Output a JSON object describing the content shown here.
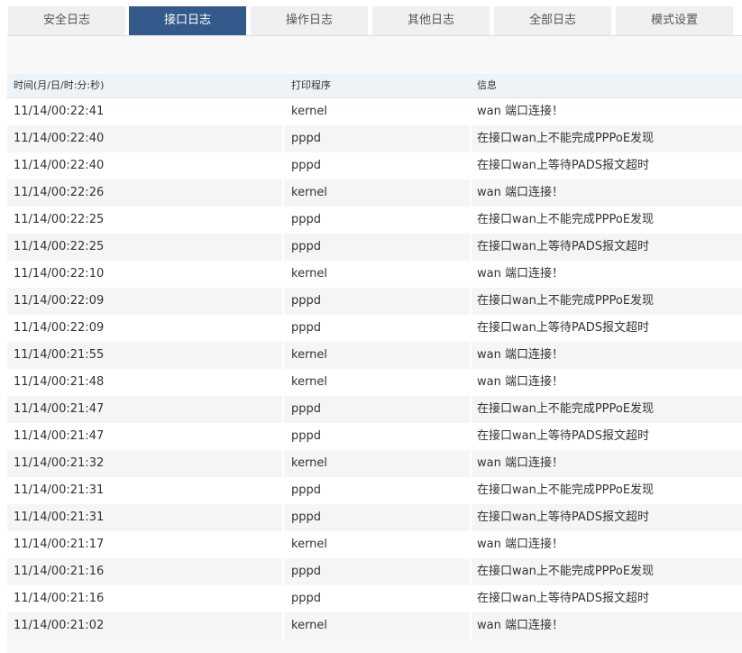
{
  "tabs": [
    {
      "label": "安全日志",
      "active": false
    },
    {
      "label": "接口日志",
      "active": true
    },
    {
      "label": "操作日志",
      "active": false
    },
    {
      "label": "其他日志",
      "active": false
    },
    {
      "label": "全部日志",
      "active": false
    },
    {
      "label": "模式设置",
      "active": false
    }
  ],
  "colors": {
    "active_tab": "#345a8c",
    "inactive_tab": "#f0f0f0",
    "header_bg": "#eef3f8"
  },
  "table": {
    "headers": {
      "time": "时间(月/日/时:分:秒)",
      "program": "打印程序",
      "info": "信息"
    },
    "rows": [
      {
        "time": "11/14/00:22:41",
        "program": "kernel",
        "info": "wan 端口连接！"
      },
      {
        "time": "11/14/00:22:40",
        "program": "pppd",
        "info": "在接口wan上不能完成PPPoE发现"
      },
      {
        "time": "11/14/00:22:40",
        "program": "pppd",
        "info": "在接口wan上等待PADS报文超时"
      },
      {
        "time": "11/14/00:22:26",
        "program": "kernel",
        "info": "wan 端口连接！"
      },
      {
        "time": "11/14/00:22:25",
        "program": "pppd",
        "info": "在接口wan上不能完成PPPoE发现"
      },
      {
        "time": "11/14/00:22:25",
        "program": "pppd",
        "info": "在接口wan上等待PADS报文超时"
      },
      {
        "time": "11/14/00:22:10",
        "program": "kernel",
        "info": "wan 端口连接！"
      },
      {
        "time": "11/14/00:22:09",
        "program": "pppd",
        "info": "在接口wan上不能完成PPPoE发现"
      },
      {
        "time": "11/14/00:22:09",
        "program": "pppd",
        "info": "在接口wan上等待PADS报文超时"
      },
      {
        "time": "11/14/00:21:55",
        "program": "kernel",
        "info": "wan 端口连接！"
      },
      {
        "time": "11/14/00:21:48",
        "program": "kernel",
        "info": "wan 端口连接！"
      },
      {
        "time": "11/14/00:21:47",
        "program": "pppd",
        "info": "在接口wan上不能完成PPPoE发现"
      },
      {
        "time": "11/14/00:21:47",
        "program": "pppd",
        "info": "在接口wan上等待PADS报文超时"
      },
      {
        "time": "11/14/00:21:32",
        "program": "kernel",
        "info": "wan 端口连接！"
      },
      {
        "time": "11/14/00:21:31",
        "program": "pppd",
        "info": "在接口wan上不能完成PPPoE发现"
      },
      {
        "time": "11/14/00:21:31",
        "program": "pppd",
        "info": "在接口wan上等待PADS报文超时"
      },
      {
        "time": "11/14/00:21:17",
        "program": "kernel",
        "info": "wan 端口连接！"
      },
      {
        "time": "11/14/00:21:16",
        "program": "pppd",
        "info": "在接口wan上不能完成PPPoE发现"
      },
      {
        "time": "11/14/00:21:16",
        "program": "pppd",
        "info": "在接口wan上等待PADS报文超时"
      },
      {
        "time": "11/14/00:21:02",
        "program": "kernel",
        "info": "wan 端口连接！"
      }
    ]
  }
}
